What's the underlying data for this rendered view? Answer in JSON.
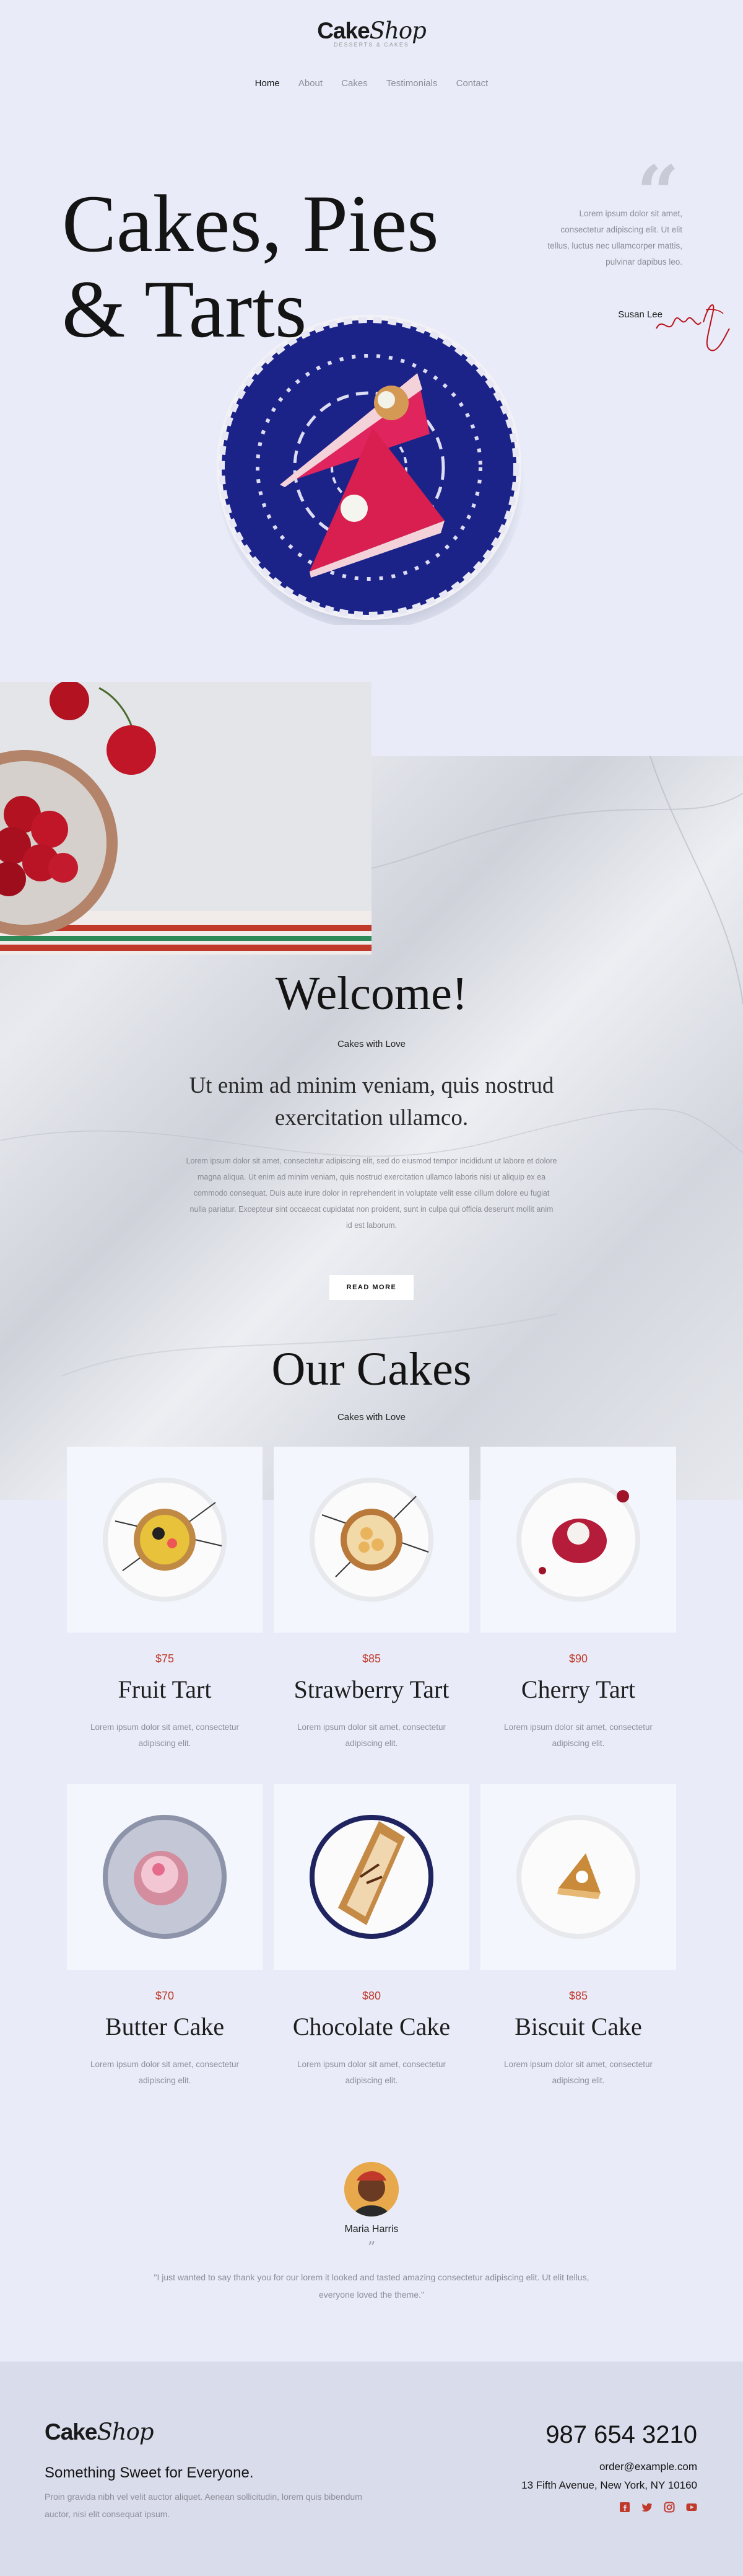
{
  "header": {
    "logo_main": "Cake",
    "logo_italic": "Shop",
    "logo_sub": "DESSERTS & CAKES",
    "nav": [
      "Home",
      "About",
      "Cakes",
      "Testimonials",
      "Contact"
    ]
  },
  "hero": {
    "title_line1": "Cakes, Pies",
    "title_line2": "& Tarts",
    "quote": "Lorem ipsum dolor sit amet, consectetur adipiscing elit. Ut elit tellus, luctus nec ullamcorper mattis, pulvinar dapibus leo.",
    "author": "Susan Lee"
  },
  "welcome": {
    "title": "Welcome!",
    "subtitle": "Cakes with Love",
    "lead": "Ut enim ad minim veniam, quis nostrud exercitation ullamco.",
    "body": "Lorem ipsum dolor sit amet, consectetur adipiscing elit, sed do eiusmod tempor incididunt ut labore et dolore magna aliqua. Ut enim ad minim veniam, quis nostrud exercitation ullamco laboris nisi ut aliquip ex ea commodo consequat. Duis aute irure dolor in reprehenderit in voluptate velit esse cillum dolore eu fugiat nulla pariatur. Excepteur sint occaecat cupidatat non proident, sunt in culpa qui officia deserunt mollit anim id est laborum.",
    "button": "READ MORE"
  },
  "cakes": {
    "title": "Our Cakes",
    "subtitle": "Cakes with Love",
    "items": [
      {
        "price": "$75",
        "name": "Fruit Tart",
        "desc": "Lorem ipsum dolor sit amet, consectetur adipiscing elit."
      },
      {
        "price": "$85",
        "name": "Strawberry Tart",
        "desc": "Lorem ipsum dolor sit amet, consectetur adipiscing elit."
      },
      {
        "price": "$90",
        "name": "Cherry Tart",
        "desc": "Lorem ipsum dolor sit amet, consectetur adipiscing elit."
      },
      {
        "price": "$70",
        "name": "Butter Cake",
        "desc": "Lorem ipsum dolor sit amet, consectetur adipiscing elit."
      },
      {
        "price": "$80",
        "name": "Chocolate Cake",
        "desc": "Lorem ipsum dolor sit amet, consectetur adipiscing elit."
      },
      {
        "price": "$85",
        "name": "Biscuit Cake",
        "desc": "Lorem ipsum dolor sit amet, consectetur adipiscing elit."
      }
    ]
  },
  "testimonial": {
    "name": "Maria Harris",
    "quote_mark": "”",
    "text": "\"I just wanted to say thank you for our lorem it looked and tasted amazing consectetur adipiscing elit. Ut elit tellus, everyone loved the theme.\""
  },
  "footer": {
    "logo_main": "Cake",
    "logo_italic": "Shop",
    "tagline": "Something Sweet for Everyone.",
    "text": "Proin gravida nibh vel velit auctor aliquet. Aenean sollicitudin, lorem quis bibendum auctor, nisi elit consequat ipsum.",
    "phone": "987 654 3210",
    "email": "order@example.com",
    "address": "13 Fifth Avenue, New York, NY 10160",
    "socials": [
      "facebook-icon",
      "twitter-icon",
      "instagram-icon",
      "youtube-icon"
    ]
  },
  "colors": {
    "background": "#e9ecf8",
    "accent": "#c0392b",
    "footer_bg": "#d9dceb"
  }
}
